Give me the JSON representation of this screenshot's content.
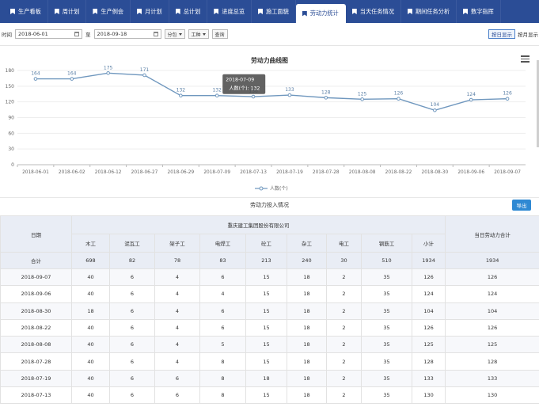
{
  "nav": {
    "tabs": [
      {
        "label": "生产看板"
      },
      {
        "label": "周计划"
      },
      {
        "label": "生产例会"
      },
      {
        "label": "月计划"
      },
      {
        "label": "总计划"
      },
      {
        "label": "进度总览"
      },
      {
        "label": "施工面貌"
      },
      {
        "label": "劳动力统计",
        "active": true
      },
      {
        "label": "当天任务情况"
      },
      {
        "label": "期间任务分析"
      },
      {
        "label": "数字指挥"
      }
    ]
  },
  "filter": {
    "time_label": "时间",
    "start_date": "2018-06-01",
    "to_label": "至",
    "end_date": "2018-09-18",
    "group_select": "分包",
    "trade_select": "工种",
    "query_label": "查询",
    "daily_label": "按日显示",
    "monthly_label": "按月显示"
  },
  "chart_data": {
    "type": "line",
    "title": "劳动力曲线图",
    "categories": [
      "2018-06-01",
      "2018-06-02",
      "2018-06-12",
      "2018-06-27",
      "2018-06-29",
      "2018-07-09",
      "2018-07-13",
      "2018-07-19",
      "2018-07-28",
      "2018-08-08",
      "2018-08-22",
      "2018-08-30",
      "2018-09-06",
      "2018-09-07"
    ],
    "series": [
      {
        "name": "人数(个)",
        "values": [
          164,
          164,
          175,
          171,
          132,
          132,
          130,
          133,
          128,
          125,
          126,
          104,
          124,
          126
        ]
      }
    ],
    "ylim": [
      0,
      180
    ],
    "yticks": [
      0,
      30,
      60,
      90,
      120,
      150,
      180
    ],
    "legend": "bottom",
    "color": "#6f97be",
    "tooltip": {
      "date": "2018-07-09",
      "text": "人数(个): 132"
    }
  },
  "section": {
    "title": "劳动力投入情况",
    "export_label": "导出"
  },
  "table": {
    "date_header": "日期",
    "company": "重庆建工集团股份有限公司",
    "daily_total_header": "当日劳动力合计",
    "columns": [
      "木工",
      "泥瓦工",
      "架子工",
      "电焊工",
      "砼工",
      "杂工",
      "电工",
      "钢筋工",
      "小计"
    ],
    "total": {
      "label": "合计",
      "values": [
        "698",
        "82",
        "78",
        "83",
        "213",
        "240",
        "30",
        "510",
        "1934"
      ],
      "daily": "1934"
    },
    "rows": [
      {
        "date": "2018-09-07",
        "values": [
          "40",
          "6",
          "4",
          "6",
          "15",
          "18",
          "2",
          "35",
          "126"
        ],
        "daily": "126"
      },
      {
        "date": "2018-09-06",
        "values": [
          "40",
          "6",
          "4",
          "4",
          "15",
          "18",
          "2",
          "35",
          "124"
        ],
        "daily": "124"
      },
      {
        "date": "2018-08-30",
        "values": [
          "18",
          "6",
          "4",
          "6",
          "15",
          "18",
          "2",
          "35",
          "104"
        ],
        "daily": "104"
      },
      {
        "date": "2018-08-22",
        "values": [
          "40",
          "6",
          "4",
          "6",
          "15",
          "18",
          "2",
          "35",
          "126"
        ],
        "daily": "126"
      },
      {
        "date": "2018-08-08",
        "values": [
          "40",
          "6",
          "4",
          "5",
          "15",
          "18",
          "2",
          "35",
          "125"
        ],
        "daily": "125"
      },
      {
        "date": "2018-07-28",
        "values": [
          "40",
          "6",
          "4",
          "8",
          "15",
          "18",
          "2",
          "35",
          "128"
        ],
        "daily": "128"
      },
      {
        "date": "2018-07-19",
        "values": [
          "40",
          "6",
          "6",
          "8",
          "18",
          "18",
          "2",
          "35",
          "133"
        ],
        "daily": "133"
      },
      {
        "date": "2018-07-13",
        "values": [
          "40",
          "6",
          "6",
          "8",
          "15",
          "18",
          "2",
          "35",
          "130"
        ],
        "daily": "130"
      }
    ]
  }
}
